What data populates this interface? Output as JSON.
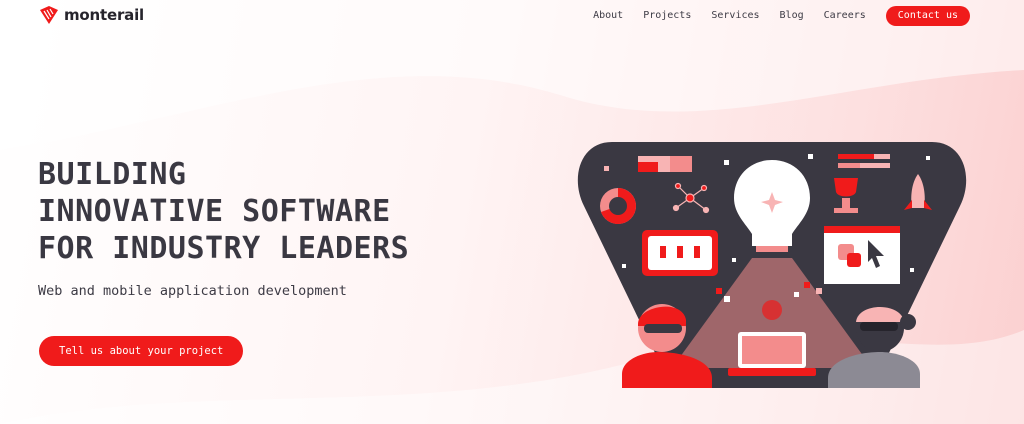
{
  "brand": {
    "name": "monterail"
  },
  "nav": {
    "items": [
      {
        "label": "About"
      },
      {
        "label": "Projects"
      },
      {
        "label": "Services"
      },
      {
        "label": "Blog"
      },
      {
        "label": "Careers"
      }
    ],
    "contact_label": "Contact us"
  },
  "hero": {
    "title_lines": [
      "BUILDING",
      "INNOVATIVE SOFTWARE",
      "FOR INDUSTRY LEADERS"
    ],
    "subtitle": "Web and mobile application development",
    "cta_label": "Tell us about your project"
  },
  "colors": {
    "accent": "#f01b1b",
    "dark": "#3a3842",
    "pink_bg": "#fbd0d0"
  },
  "illustration": {
    "icons": [
      "pie-chart-icon",
      "network-icon",
      "lightbulb-icon",
      "trophy-icon",
      "rocket-icon",
      "cursor-window-icon",
      "progress-bars-icon",
      "laptop-icon"
    ]
  }
}
